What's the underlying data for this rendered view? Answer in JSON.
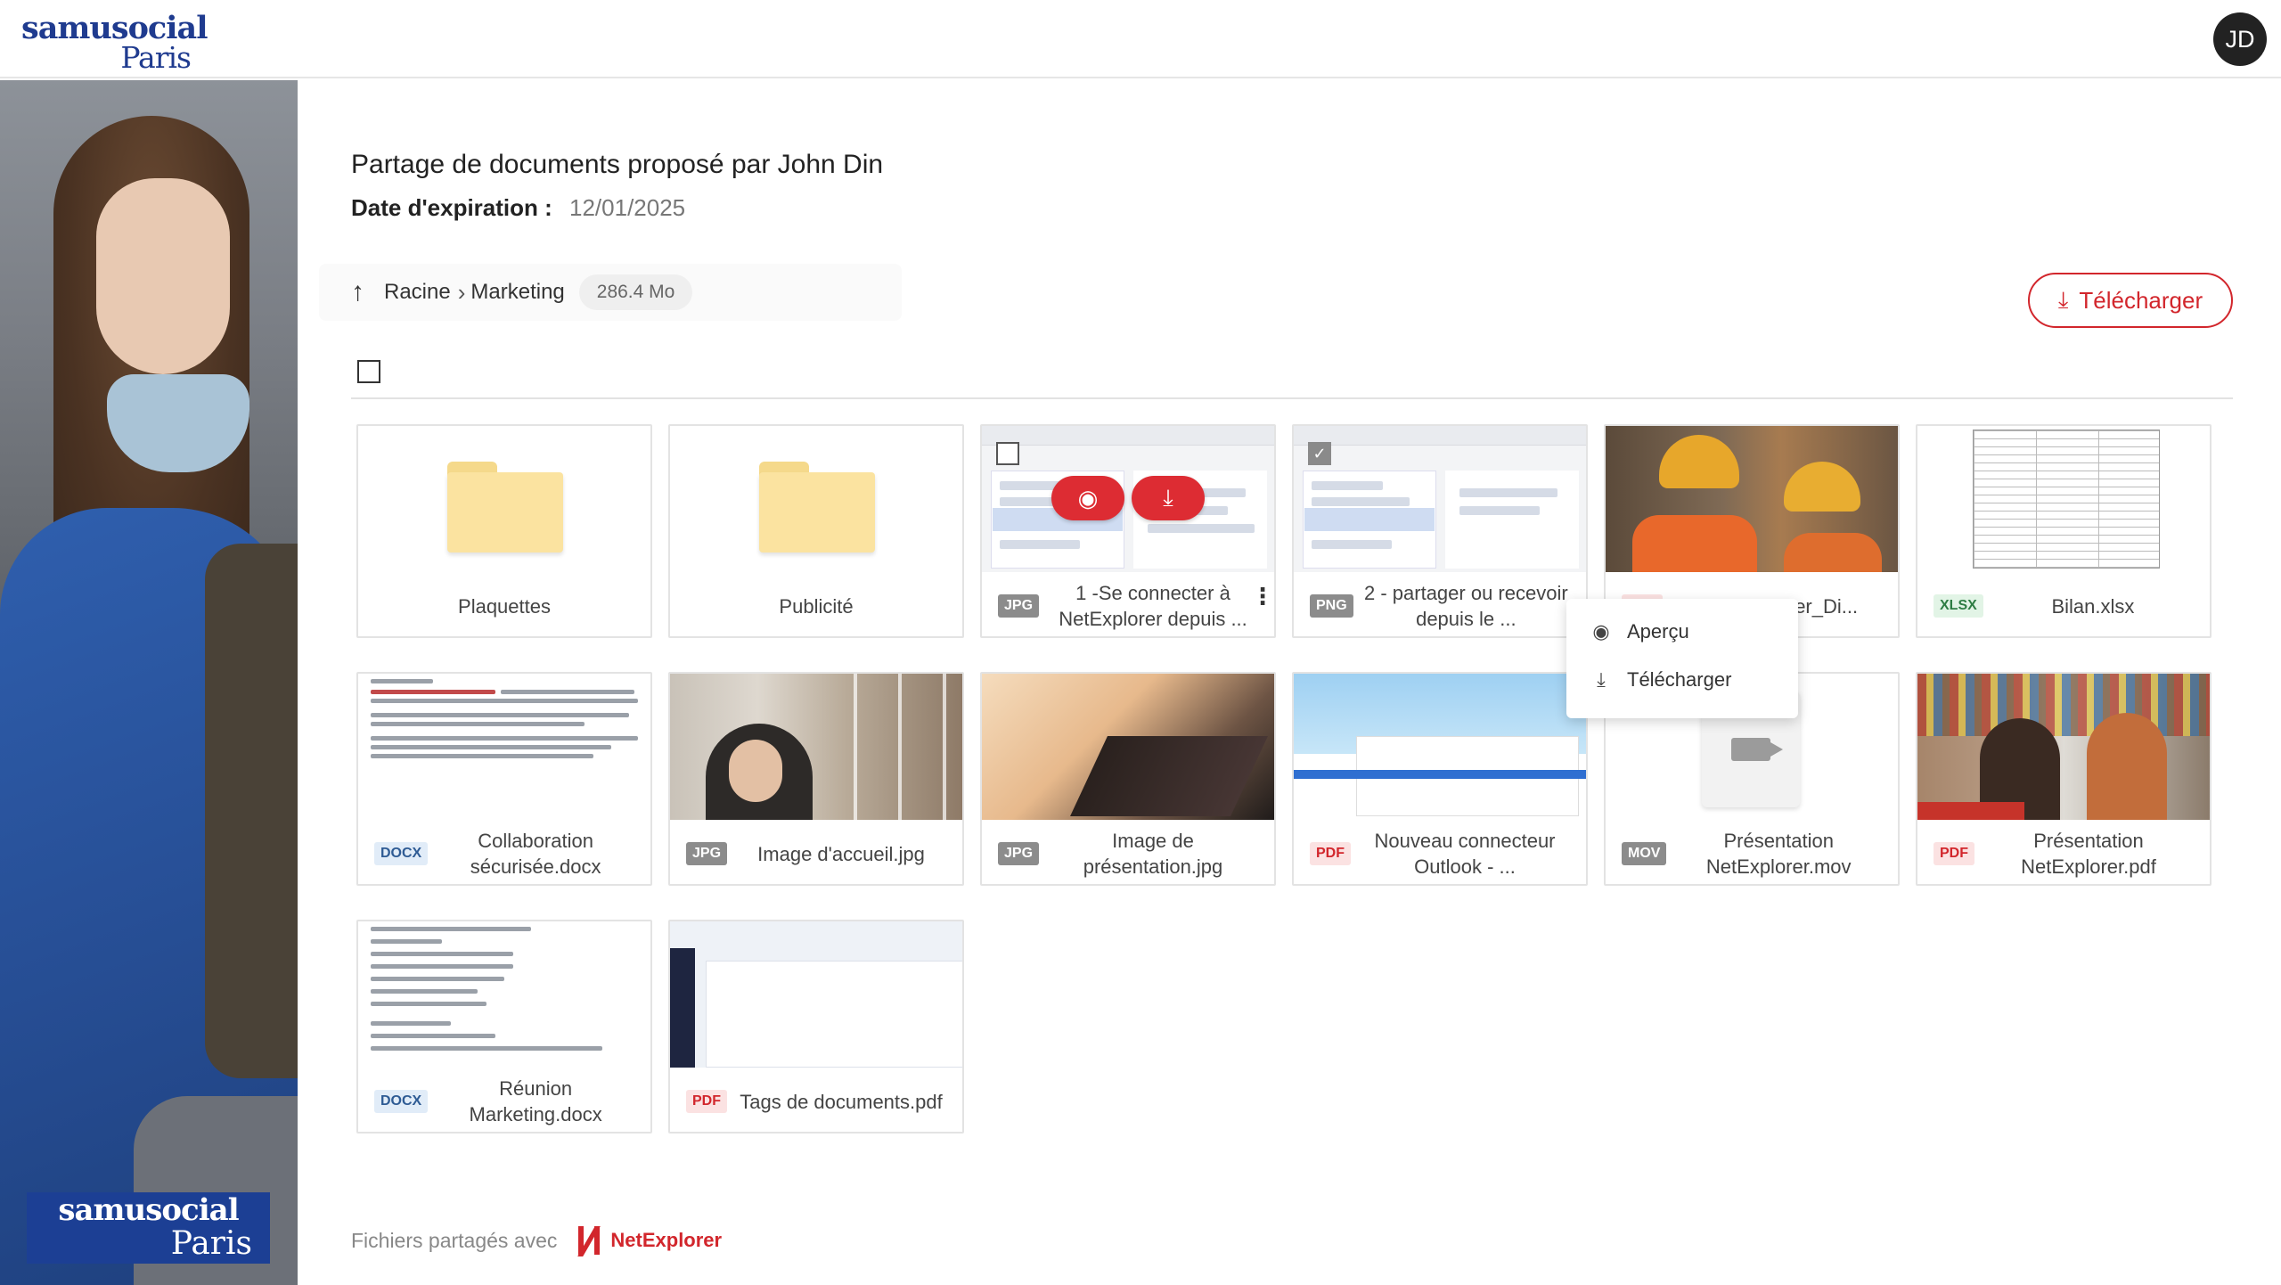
{
  "header": {
    "logo_line1": "samusocial",
    "logo_line2": "Paris",
    "avatar_initials": "JD"
  },
  "sidebar": {
    "brand_line1": "samusocial",
    "brand_line2": "Paris"
  },
  "share": {
    "title": "Partage de documents proposé par John Din",
    "expiry_label": "Date d'expiration :",
    "expiry_value": "12/01/2025"
  },
  "breadcrumb": {
    "root": "Racine",
    "current": "Marketing",
    "size": "286.4 Mo"
  },
  "actions": {
    "download_label": "Télécharger"
  },
  "files": [
    {
      "name": "Plaquettes",
      "type": "folder"
    },
    {
      "name": "Publicité",
      "type": "folder"
    },
    {
      "name": "1 -Se connecter à NetExplorer depuis ...",
      "badge": "JPG",
      "selected": false
    },
    {
      "name": "2 - partager ou recevoir depuis le ...",
      "badge": "PNG",
      "selected": true
    },
    {
      "name": "2024 10 ...rer_Di...",
      "badge": "PDF"
    },
    {
      "name": "Bilan.xlsx",
      "badge": "XLSX"
    },
    {
      "name": "Collaboration sécurisée.docx",
      "badge": "DOCX"
    },
    {
      "name": "Image d'accueil.jpg",
      "badge": "JPG"
    },
    {
      "name": "Image de présentation.jpg",
      "badge": "JPG"
    },
    {
      "name": "Nouveau connecteur Outlook - ...",
      "badge": "PDF"
    },
    {
      "name": "Présentation NetExplorer.mov",
      "badge": "MOV"
    },
    {
      "name": "Présentation NetExplorer.pdf",
      "badge": "PDF"
    },
    {
      "name": "Réunion Marketing.docx",
      "badge": "DOCX"
    },
    {
      "name": "Tags de documents.pdf",
      "badge": "PDF"
    }
  ],
  "context_menu": {
    "preview": "Aperçu",
    "download": "Télécharger"
  },
  "footer": {
    "shared_with": "Fichiers partagés avec",
    "brand": "NetExplorer"
  },
  "colors": {
    "accent": "#d2262c",
    "brand_blue": "#1c3f94"
  }
}
